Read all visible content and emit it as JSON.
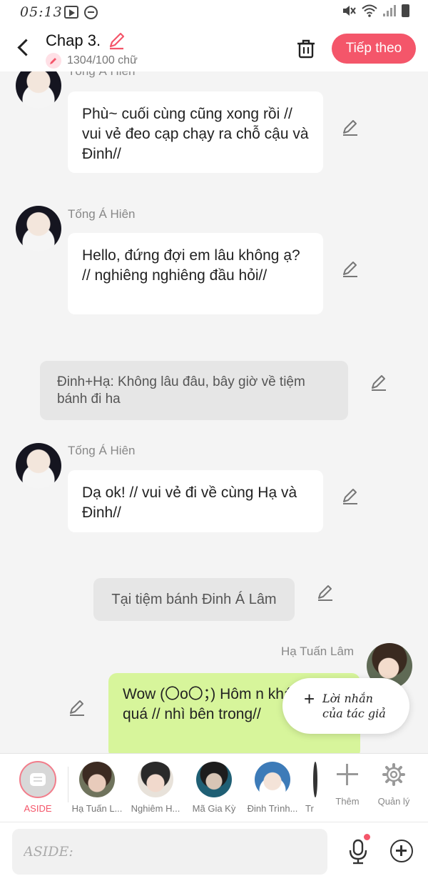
{
  "status_bar": {
    "time": "05:13"
  },
  "header": {
    "title": "Chap 3.",
    "word_count": "1304/100 chữ",
    "next_label": "Tiếp theo"
  },
  "chat": {
    "messages": [
      {
        "type": "character",
        "sender": "Tống Á Hiên",
        "text": "Phù~ cuối cùng cũng xong rồi // vui vẻ đeo cạp chạy ra chỗ cậu và Đinh//"
      },
      {
        "type": "character",
        "sender": "Tống Á Hiên",
        "text": "Hello, đứng đợi em lâu không ạ? // nghiêng nghiêng đầu hỏi//"
      },
      {
        "type": "narration",
        "text": "Đinh+Hạ: Không lâu đâu, bây giờ về tiệm bánh đi ha"
      },
      {
        "type": "character",
        "sender": "Tống Á Hiên",
        "text": "Dạ ok! // vui vẻ đi về cùng Hạ và Đinh//"
      },
      {
        "type": "narration",
        "text": "Tại tiệm bánh Đinh Á Lâm"
      },
      {
        "type": "self",
        "sender": "Hạ Tuấn Lâm",
        "text": "Wow (〇o〇；) Hôm n khách đông quá // nhì bên trong//"
      }
    ],
    "author_note": {
      "line1": "Lời nhắn",
      "line2": "của tác giả"
    }
  },
  "character_bar": {
    "aside_label": "ASIDE",
    "characters": [
      "Hạ Tuấn L...",
      "Nghiêm H...",
      "Mã Gia Kỳ",
      "Đinh Trình...",
      "Tr"
    ],
    "add_label": "Thêm",
    "manage_label": "Quản lý"
  },
  "input_bar": {
    "placeholder": "ASIDE:"
  },
  "colors": {
    "accent": "#f4566a",
    "self_bubble": "#d7f59b",
    "narration_bg": "#e6e6e6",
    "background": "#f4f4f4"
  }
}
